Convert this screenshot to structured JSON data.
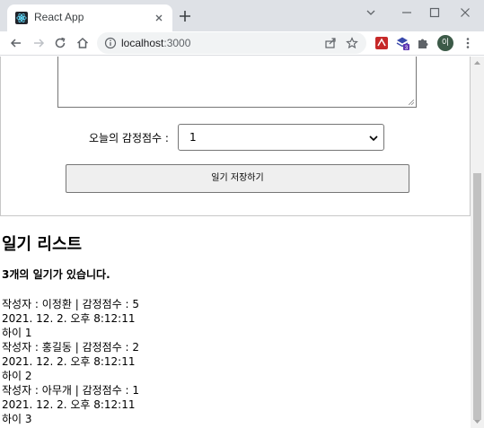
{
  "browser": {
    "tab_title": "React App",
    "url_host": "localhost",
    "url_port": ":3000",
    "profile_initial": "이",
    "extension_badge": "3",
    "accent": "#1a73e8"
  },
  "form": {
    "emotion_label": "오늘의 감정점수 :",
    "emotion_value": "1",
    "save_label": "일기 저장하기"
  },
  "list": {
    "title": "일기 리스트",
    "count_text": "3개의 일기가 있습니다.",
    "entries": [
      {
        "meta": "작성자 : 이정환 | 감정점수 : 5",
        "date": "2021. 12. 2. 오후 8:12:11",
        "content": "하이 1"
      },
      {
        "meta": "작성자 : 홍길동 | 감정점수 : 2",
        "date": "2021. 12. 2. 오후 8:12:11",
        "content": "하이 2"
      },
      {
        "meta": "작성자 : 아무개 | 감정점수 : 1",
        "date": "2021. 12. 2. 오후 8:12:11",
        "content": "하이 3"
      }
    ]
  }
}
